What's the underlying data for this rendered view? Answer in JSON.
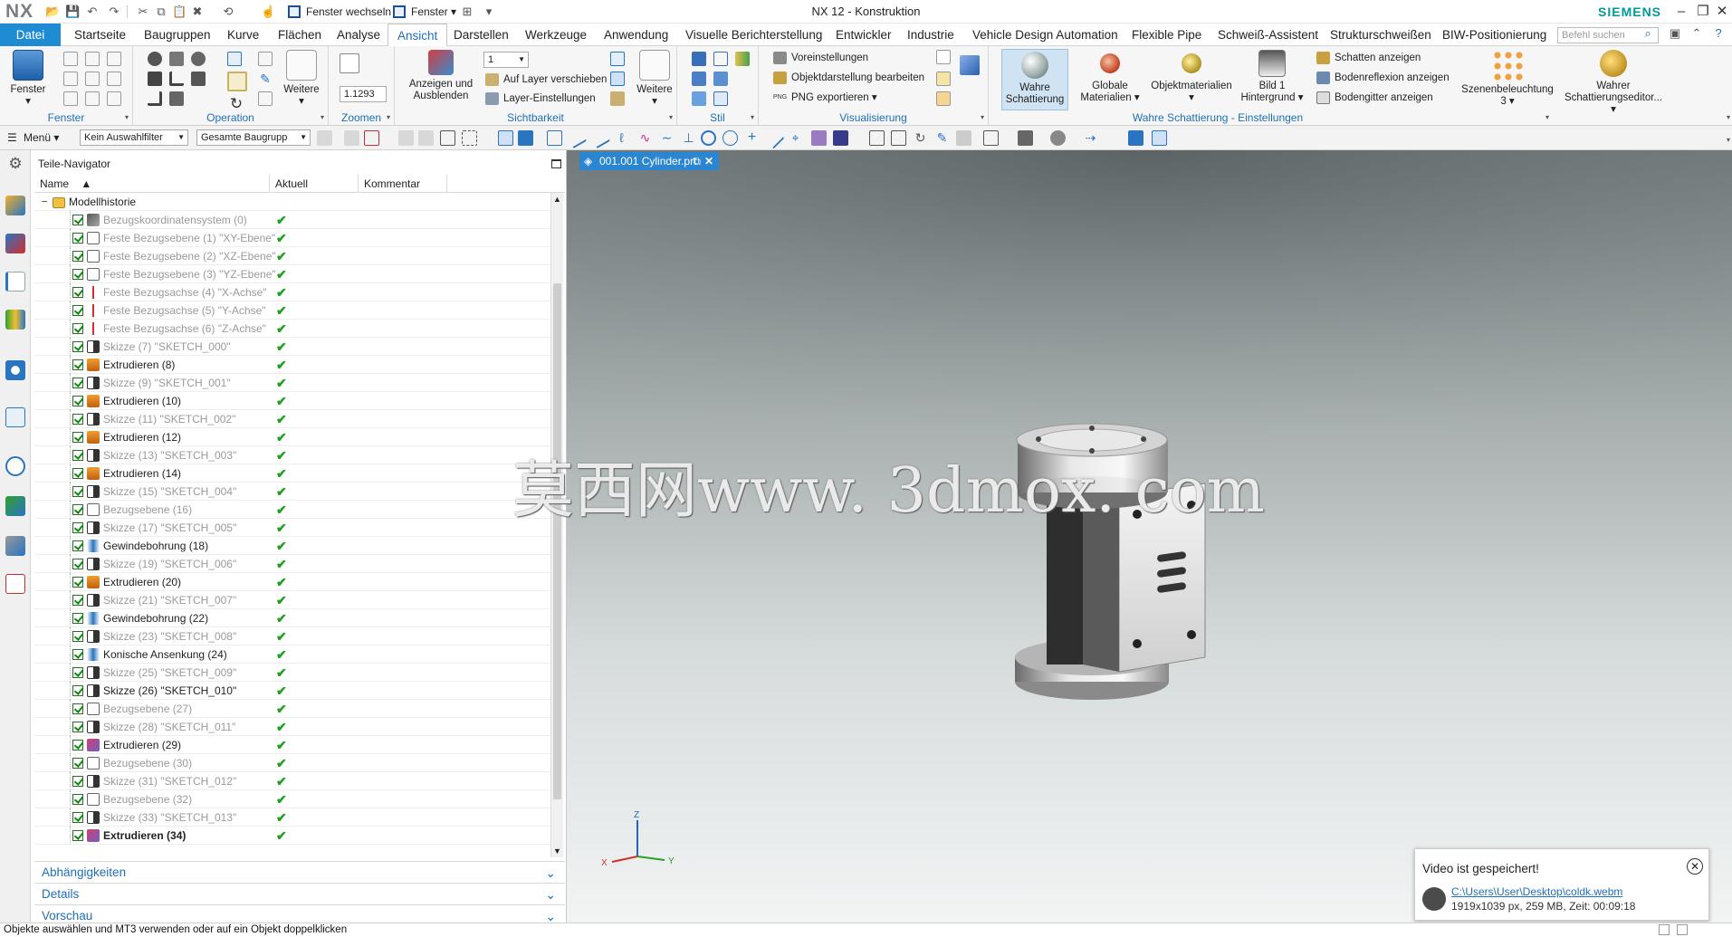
{
  "titlebar": {
    "logo": "NX",
    "window_title": "NX 12 - Konstruktion",
    "switch_window": "Fenster wechseln",
    "window_menu": "Fenster",
    "brand": "SIEMENS",
    "minimize": "–",
    "restore": "❐",
    "close": "✕"
  },
  "menu": {
    "tabs": [
      "Datei",
      "Startseite",
      "Baugruppen",
      "Kurve",
      "Flächen",
      "Analyse",
      "Ansicht",
      "Darstellen",
      "Werkzeuge",
      "Anwendung",
      "Visuelle Berichterstellung",
      "Entwickler",
      "Industrie",
      "Vehicle Design Automation",
      "Flexible Pipe",
      "Schweiß-Assistent",
      "Strukturschweißen",
      "BIW-Positionierung"
    ],
    "active_tab": "Ansicht",
    "search_placeholder": "Befehl suchen"
  },
  "ribbon": {
    "fenster": {
      "label": "Fenster",
      "button": "Fenster"
    },
    "operation": {
      "label": "Operation",
      "weitere": "Weitere"
    },
    "zoomen": {
      "label": "Zoomen",
      "value": "1.1293"
    },
    "sichtbarkeit": {
      "label": "Sichtbarkeit",
      "show_hide": "Anzeigen und Ausblenden",
      "layer_value": "1",
      "move_to_layer": "Auf Layer verschieben",
      "layer_settings": "Layer-Einstellungen",
      "weitere": "Weitere"
    },
    "stil": {
      "label": "Stil"
    },
    "visualisierung": {
      "label": "Visualisierung",
      "preferences": "Voreinstellungen",
      "edit_display": "Objektdarstellung bearbeiten",
      "png_export": "PNG exportieren",
      "png_tag": "PNG"
    },
    "true_shading": {
      "label": "Wahre Schattierung - Einstellungen",
      "true_shading": "Wahre Schattierung",
      "global_materials": "Globale Materialien",
      "object_materials": "Objektmaterialien",
      "background": "Bild 1 Hintergrund",
      "show_shadows": "Schatten anzeigen",
      "floor_reflection": "Bodenreflexion anzeigen",
      "floor_grid": "Bodengitter anzeigen",
      "scene_lighting": "Szenenbeleuchtung 3",
      "editor": "Wahrer Schattierungseditor..."
    }
  },
  "toolbar2": {
    "menu": "Menü",
    "selection_filter": "Kein Auswahlfilter",
    "scope": "Gesamte Baugrupp"
  },
  "navigator": {
    "title": "Teile-Navigator",
    "columns": [
      "Name",
      "Aktuell",
      "Kommentar"
    ],
    "root": "Modellhistorie",
    "rows": [
      {
        "label": "Bezugskoordinatensystem (0)",
        "grey": true,
        "bold": false,
        "icon": "csys"
      },
      {
        "label": "Feste Bezugsebene (1) \"XY-Ebene\"",
        "grey": true,
        "bold": false,
        "icon": "plane"
      },
      {
        "label": "Feste Bezugsebene (2) \"XZ-Ebene\"",
        "grey": true,
        "bold": false,
        "icon": "plane"
      },
      {
        "label": "Feste Bezugsebene (3) \"YZ-Ebene\"",
        "grey": true,
        "bold": false,
        "icon": "plane"
      },
      {
        "label": "Feste Bezugsachse (4) \"X-Achse\"",
        "grey": true,
        "bold": false,
        "icon": "axis"
      },
      {
        "label": "Feste Bezugsachse (5) \"Y-Achse\"",
        "grey": true,
        "bold": false,
        "icon": "axis"
      },
      {
        "label": "Feste Bezugsachse (6) \"Z-Achse\"",
        "grey": true,
        "bold": false,
        "icon": "axis"
      },
      {
        "label": "Skizze (7) \"SKETCH_000\"",
        "grey": true,
        "bold": false,
        "icon": "sketch"
      },
      {
        "label": "Extrudieren (8)",
        "grey": false,
        "bold": false,
        "icon": "extrude"
      },
      {
        "label": "Skizze (9) \"SKETCH_001\"",
        "grey": true,
        "bold": false,
        "icon": "sketch"
      },
      {
        "label": "Extrudieren (10)",
        "grey": false,
        "bold": false,
        "icon": "extrude"
      },
      {
        "label": "Skizze (11) \"SKETCH_002\"",
        "grey": true,
        "bold": false,
        "icon": "sketch"
      },
      {
        "label": "Extrudieren (12)",
        "grey": false,
        "bold": false,
        "icon": "extrude"
      },
      {
        "label": "Skizze (13) \"SKETCH_003\"",
        "grey": true,
        "bold": false,
        "icon": "sketch"
      },
      {
        "label": "Extrudieren (14)",
        "grey": false,
        "bold": false,
        "icon": "extrude"
      },
      {
        "label": "Skizze (15) \"SKETCH_004\"",
        "grey": true,
        "bold": false,
        "icon": "sketch"
      },
      {
        "label": "Bezugsebene (16)",
        "grey": true,
        "bold": false,
        "icon": "plane"
      },
      {
        "label": "Skizze (17) \"SKETCH_005\"",
        "grey": true,
        "bold": false,
        "icon": "sketch"
      },
      {
        "label": "Gewindebohrung (18)",
        "grey": false,
        "bold": false,
        "icon": "hole"
      },
      {
        "label": "Skizze (19) \"SKETCH_006\"",
        "grey": true,
        "bold": false,
        "icon": "sketch"
      },
      {
        "label": "Extrudieren (20)",
        "grey": false,
        "bold": false,
        "icon": "extrude"
      },
      {
        "label": "Skizze (21) \"SKETCH_007\"",
        "grey": true,
        "bold": false,
        "icon": "sketch"
      },
      {
        "label": "Gewindebohrung (22)",
        "grey": false,
        "bold": false,
        "icon": "hole"
      },
      {
        "label": "Skizze (23) \"SKETCH_008\"",
        "grey": true,
        "bold": false,
        "icon": "sketch"
      },
      {
        "label": "Konische Ansenkung (24)",
        "grey": false,
        "bold": false,
        "icon": "hole"
      },
      {
        "label": "Skizze (25) \"SKETCH_009\"",
        "grey": true,
        "bold": false,
        "icon": "sketch"
      },
      {
        "label": "Skizze (26) \"SKETCH_010\"",
        "grey": false,
        "bold": false,
        "icon": "sketch"
      },
      {
        "label": "Bezugsebene (27)",
        "grey": true,
        "bold": false,
        "icon": "plane"
      },
      {
        "label": "Skizze (28) \"SKETCH_011\"",
        "grey": true,
        "bold": false,
        "icon": "sketch"
      },
      {
        "label": "Extrudieren (29)",
        "grey": false,
        "bold": false,
        "icon": "extrude2"
      },
      {
        "label": "Bezugsebene (30)",
        "grey": true,
        "bold": false,
        "icon": "plane"
      },
      {
        "label": "Skizze (31) \"SKETCH_012\"",
        "grey": true,
        "bold": false,
        "icon": "sketch"
      },
      {
        "label": "Bezugsebene (32)",
        "grey": true,
        "bold": false,
        "icon": "plane"
      },
      {
        "label": "Skizze (33) \"SKETCH_013\"",
        "grey": true,
        "bold": false,
        "icon": "sketch"
      },
      {
        "label": "Extrudieren (34)",
        "grey": false,
        "bold": true,
        "icon": "extrude2"
      }
    ],
    "panels": [
      "Abhängigkeiten",
      "Details",
      "Vorschau"
    ]
  },
  "viewport": {
    "tab_label": "001.001 Cylinder.prt",
    "watermark": "莫西网www. 3dmox. com",
    "triad": {
      "x": "X",
      "y": "Y",
      "z": "Z"
    }
  },
  "toast": {
    "title": "Video ist gespeichert!",
    "path": "C:\\Users\\User\\Desktop\\coldk.webm",
    "info": "1919x1039 px, 259 MB, Zeit:   00:09:18"
  },
  "status": "Objekte auswählen und MT3 verwenden oder auf ein Objekt doppelklicken",
  "colors": {
    "accent": "#1f8bd2",
    "label_blue": "#1f6fb8",
    "check_green": "#1aa01a",
    "brand": "#009999"
  }
}
